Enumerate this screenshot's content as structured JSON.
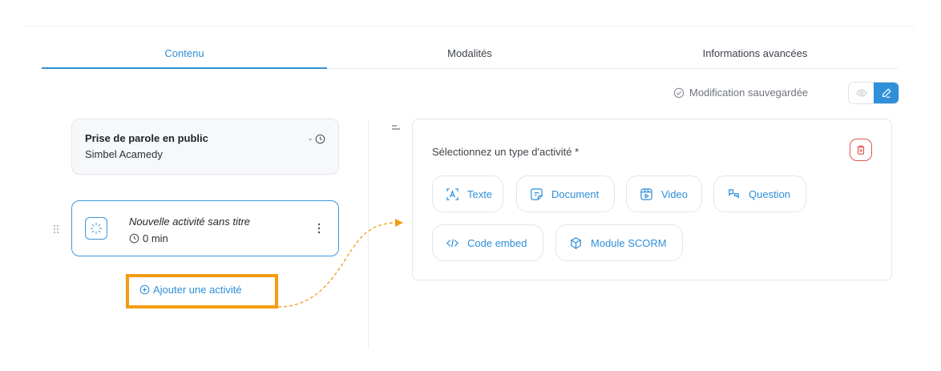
{
  "tabs": [
    {
      "label": "Contenu",
      "active": true
    },
    {
      "label": "Modalités",
      "active": false
    },
    {
      "label": "Informations avancées",
      "active": false
    }
  ],
  "save_status": {
    "text": "Modification sauvegardée",
    "icon": "check-circle-icon"
  },
  "view_toggle": {
    "options": [
      "preview-eye-icon",
      "edit-pencil-icon"
    ],
    "selected": "edit"
  },
  "course": {
    "title": "Prise de parole en public",
    "subtitle": "Simbel Acamedy",
    "duration": "-"
  },
  "activity": {
    "title": "Nouvelle activité sans titre",
    "duration": "0 min",
    "icon": "loading-icon"
  },
  "add_activity": {
    "label": "Ajouter une activité"
  },
  "type_panel": {
    "label": "Sélectionnez un type d'activité *",
    "types": [
      {
        "label": "Texte",
        "icon": "text-icon"
      },
      {
        "label": "Document",
        "icon": "document-icon"
      },
      {
        "label": "Video",
        "icon": "video-icon"
      },
      {
        "label": "Question",
        "icon": "question-icon"
      },
      {
        "label": "Code embed",
        "icon": "code-icon"
      },
      {
        "label": "Module SCORM",
        "icon": "package-icon"
      }
    ]
  },
  "colors": {
    "accent": "#2f8fd8",
    "highlight": "#f39c12",
    "danger": "#e0574f"
  }
}
